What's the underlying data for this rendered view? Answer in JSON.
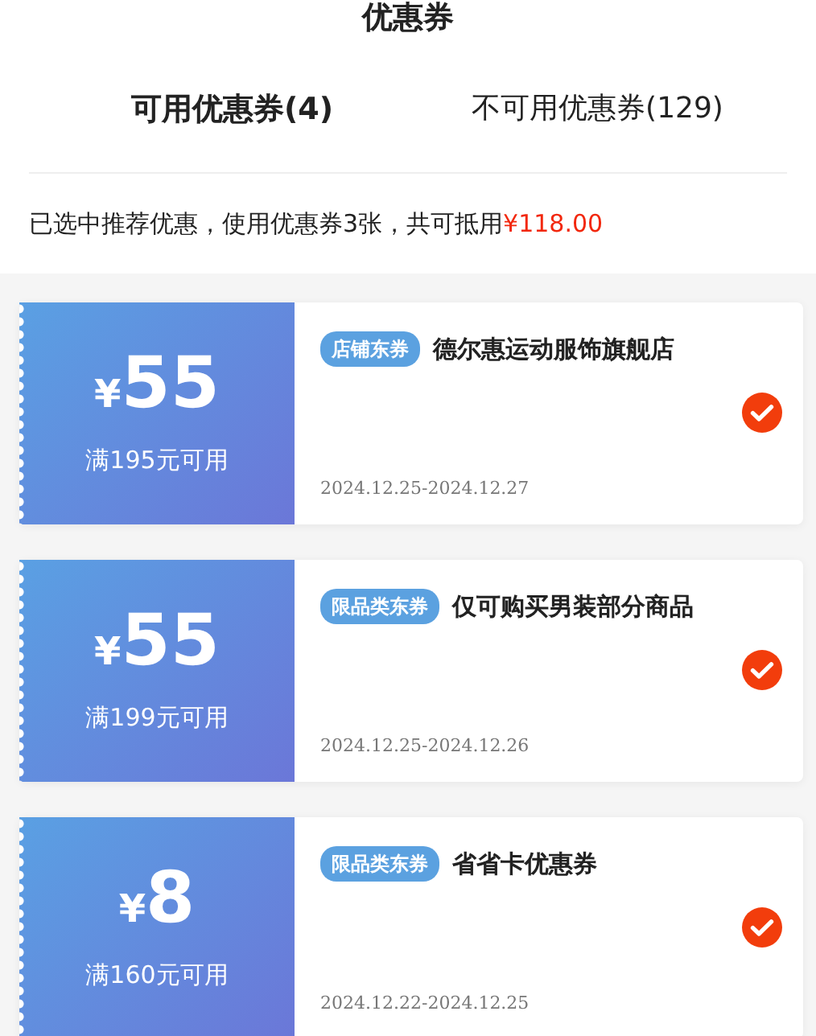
{
  "page_title": "优惠券",
  "tabs": [
    {
      "label": "可用优惠券(4)",
      "selected": true
    },
    {
      "label": "不可用优惠券(129)",
      "selected": false
    }
  ],
  "summary": {
    "text": "已选中推荐优惠，使用优惠券3张，共可抵用",
    "amount": "¥118.00"
  },
  "coupons": [
    {
      "currency": "¥",
      "amount": "55",
      "condition": "满195元可用",
      "tag": "店铺东券",
      "name": "德尔惠运动服饰旗舰店",
      "dates": "2024.12.25-2024.12.27",
      "selected": true
    },
    {
      "currency": "¥",
      "amount": "55",
      "condition": "满199元可用",
      "tag": "限品类东券",
      "name": "仅可购买男装部分商品",
      "dates": "2024.12.25-2024.12.26",
      "selected": true
    },
    {
      "currency": "¥",
      "amount": "8",
      "condition": "满160元可用",
      "tag": "限品类东券",
      "name": "省省卡优惠券",
      "dates": "2024.12.22-2024.12.25",
      "selected": true
    }
  ]
}
